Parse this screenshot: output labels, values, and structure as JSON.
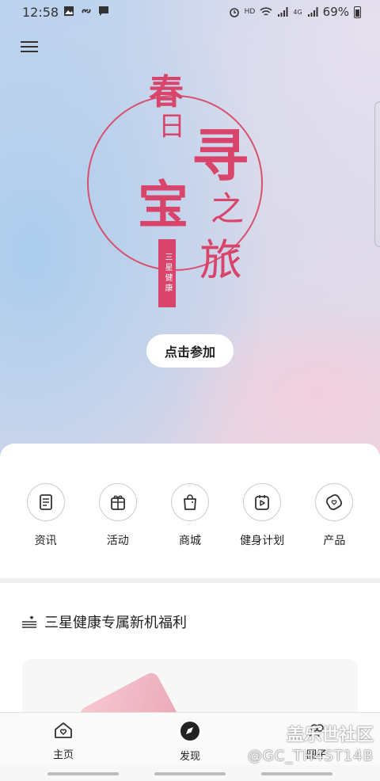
{
  "status_bar": {
    "time": "12:58",
    "network": "HD",
    "signal": "4G",
    "battery": "69%"
  },
  "banner": {
    "logo_chars": [
      "春",
      "日",
      "寻",
      "宝",
      "之",
      "旅"
    ],
    "logo_tag": "三星健康",
    "cta_label": "点击参加"
  },
  "categories": [
    {
      "label": "资讯",
      "icon": "news-icon"
    },
    {
      "label": "活动",
      "icon": "gift-icon"
    },
    {
      "label": "商城",
      "icon": "shopping-bag-icon"
    },
    {
      "label": "健身计划",
      "icon": "play-calendar-icon"
    },
    {
      "label": "产品",
      "icon": "watch-icon"
    }
  ],
  "section": {
    "title": "三星健康专属新机福利"
  },
  "bottom_nav": [
    {
      "label": "主页",
      "icon": "home-heart-icon"
    },
    {
      "label": "发现",
      "icon": "compass-icon",
      "active": true
    },
    {
      "label": "圈子",
      "icon": "community-icon"
    }
  ],
  "watermark": {
    "line1": "盖乐世社区",
    "line2": "@GC_TH4ST14B"
  },
  "colors": {
    "accent": "#d9456a",
    "text": "#222222"
  }
}
